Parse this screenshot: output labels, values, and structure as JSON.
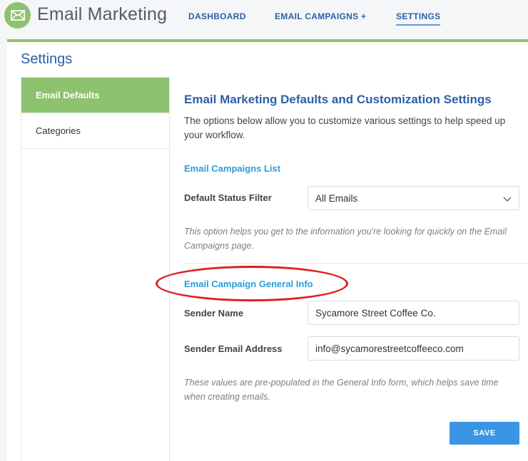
{
  "header": {
    "app_title": "Email Marketing",
    "logo_icon": "envelope-icon",
    "nav": [
      {
        "label": "DASHBOARD"
      },
      {
        "label": "EMAIL CAMPAIGNS +"
      },
      {
        "label": "SETTINGS",
        "active": true
      }
    ]
  },
  "page": {
    "title": "Settings"
  },
  "sidebar": {
    "items": [
      {
        "label": "Email Defaults",
        "active": true
      },
      {
        "label": "Categories"
      }
    ]
  },
  "content": {
    "heading": "Email Marketing Defaults and Customization Settings",
    "intro": "The options below allow you to customize various settings to help speed up your workflow.",
    "campaigns_list": {
      "title": "Email Campaigns List",
      "status_filter_label": "Default Status Filter",
      "status_filter_value": "All Emails",
      "help": "This option helps you get to the information you're looking for quickly on the Email Campaigns page."
    },
    "general_info": {
      "title": "Email Campaign General Info",
      "sender_name_label": "Sender Name",
      "sender_name_value": "Sycamore Street Coffee Co.",
      "sender_email_label": "Sender Email Address",
      "sender_email_value": "info@sycamorestreetcoffeeco.com",
      "help": "These values are pre-populated in the General Info form, which helps save time when creating emails."
    },
    "save_label": "SAVE"
  },
  "colors": {
    "accent_green": "#8dc26f",
    "primary_blue": "#2e5ea8",
    "sub_blue": "#2a9fd8",
    "button_blue": "#3a95e4",
    "annotation_red": "#e01e1e"
  }
}
